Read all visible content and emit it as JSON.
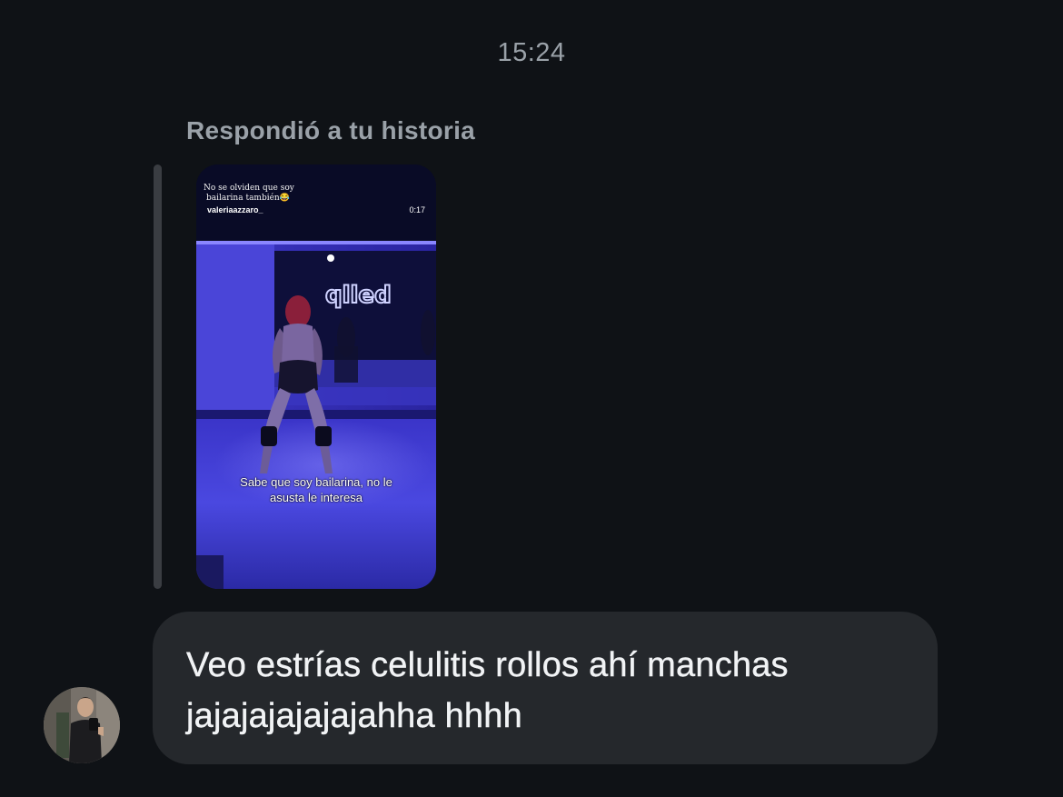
{
  "conversation": {
    "timestamp": "15:24",
    "reply_context": "Respondió a tu historia"
  },
  "story": {
    "caption_line1": "No se olviden que soy",
    "caption_line2": "bailarina también😂",
    "username": "valeriaazzaro_",
    "duration": "0:17",
    "subtitle_line1": "Sabe que soy bailarina, no le",
    "subtitle_line2": "asusta le interesa",
    "neon_sign": "qlled"
  },
  "message": {
    "line1": "Veo estrías celulitis rollos ahí manchas",
    "line2": "jajajajajajajahha hhhh"
  },
  "sender": {
    "avatar_icon": "user-avatar"
  }
}
